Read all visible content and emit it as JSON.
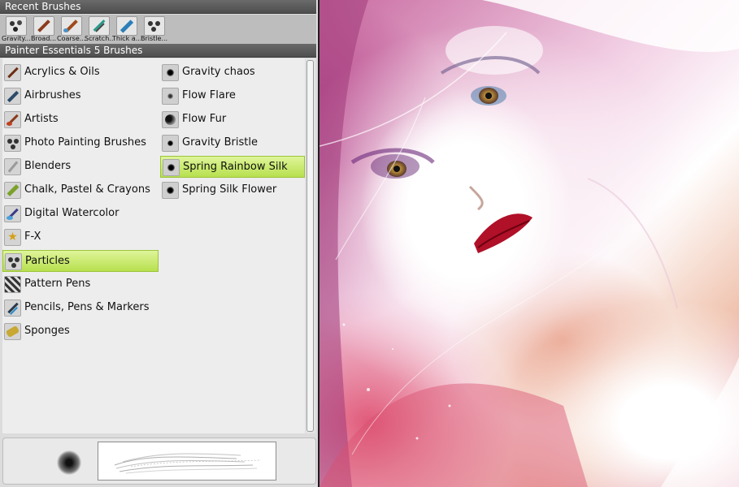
{
  "recent_brushes": {
    "title": "Recent Brushes",
    "items": [
      {
        "label": "Gravity...",
        "icon": "particles-icon"
      },
      {
        "label": "Broad...",
        "icon": "broad-brush-icon"
      },
      {
        "label": "Coarse...",
        "icon": "coarse-brush-icon"
      },
      {
        "label": "Scratch...",
        "icon": "scratch-brush-icon"
      },
      {
        "label": "Thick a...",
        "icon": "thick-brush-icon"
      },
      {
        "label": "Bristle...",
        "icon": "bristle-brush-icon"
      }
    ]
  },
  "brush_library": {
    "title": "Painter Essentials 5 Brushes",
    "categories": [
      {
        "label": "Acrylics & Oils",
        "icon": "acrylics-icon"
      },
      {
        "label": "Airbrushes",
        "icon": "airbrush-icon"
      },
      {
        "label": "Artists",
        "icon": "artists-icon"
      },
      {
        "label": "Photo Painting Brushes",
        "icon": "photo-painting-icon"
      },
      {
        "label": "Blenders",
        "icon": "blenders-icon"
      },
      {
        "label": "Chalk, Pastel & Crayons",
        "icon": "chalk-icon"
      },
      {
        "label": "Digital Watercolor",
        "icon": "watercolor-icon"
      },
      {
        "label": "F-X",
        "icon": "fx-star-icon"
      },
      {
        "label": "Particles",
        "icon": "particles-icon"
      },
      {
        "label": "Pattern Pens",
        "icon": "pattern-pens-icon"
      },
      {
        "label": "Pencils, Pens & Markers",
        "icon": "pencils-icon"
      },
      {
        "label": "Sponges",
        "icon": "sponge-icon"
      }
    ],
    "selected_category": "Particles",
    "variants": [
      {
        "label": "Gravity chaos"
      },
      {
        "label": "Flow Flare"
      },
      {
        "label": "Flow Fur"
      },
      {
        "label": "Gravity Bristle"
      },
      {
        "label": "Spring Rainbow Silk"
      },
      {
        "label": "Spring Silk Flower"
      }
    ],
    "selected_variant": "Spring Rainbow Silk"
  },
  "colors": {
    "selection": "#b7e04e",
    "header": "#5a5a5a",
    "panel_bg": "#dcdcdc"
  }
}
